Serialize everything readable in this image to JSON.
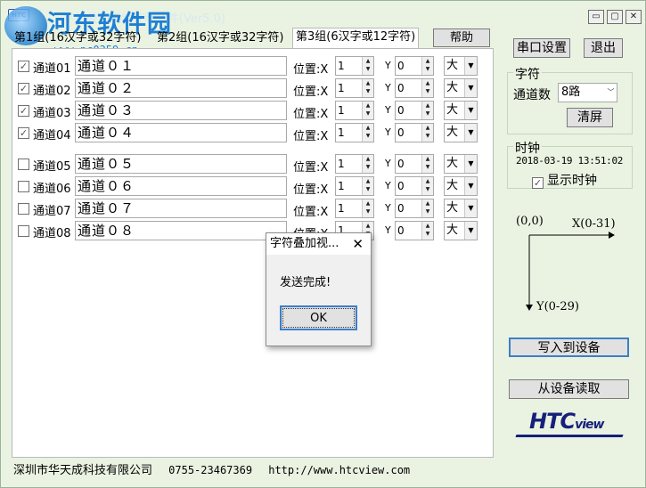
{
  "titlebar": {
    "app_icon": "HTC",
    "title": "字符叠加视频控制软件(Ver5.0)",
    "watermark_name": "河东软件园",
    "watermark_url": "www.pc0359.cn",
    "minimize": "▭",
    "maximize": "▢",
    "close": "✕"
  },
  "tabs": [
    {
      "label": "第1组(16汉字或32字符)"
    },
    {
      "label": "第2组(16汉字或32字符)"
    },
    {
      "label": "第3组(6汉字或12字符)"
    }
  ],
  "help_label": "帮助",
  "position_label": "位置:X",
  "y_label": "Y",
  "channels": [
    {
      "checked": true,
      "label": "通道01",
      "text": "通道０１",
      "x": "1",
      "y": "0",
      "size": "大"
    },
    {
      "checked": true,
      "label": "通道02",
      "text": "通道０２",
      "x": "1",
      "y": "0",
      "size": "大"
    },
    {
      "checked": true,
      "label": "通道03",
      "text": "通道０３",
      "x": "1",
      "y": "0",
      "size": "大"
    },
    {
      "checked": true,
      "label": "通道04",
      "text": "通道０４",
      "x": "1",
      "y": "0",
      "size": "大"
    },
    {
      "checked": false,
      "label": "通道05",
      "text": "通道０５",
      "x": "1",
      "y": "0",
      "size": "大"
    },
    {
      "checked": false,
      "label": "通道06",
      "text": "通道０６",
      "x": "1",
      "y": "0",
      "size": "大"
    },
    {
      "checked": false,
      "label": "通道07",
      "text": "通道０７",
      "x": "1",
      "y": "0",
      "size": "大"
    },
    {
      "checked": false,
      "label": "通道08",
      "text": "通道０８",
      "x": "1",
      "y": "0",
      "size": "大"
    }
  ],
  "right": {
    "serial_settings": "串口设置",
    "exit": "退出",
    "char_group": "字符",
    "channel_count_label": "通道数",
    "channel_count_value": "8路",
    "clear": "清屏",
    "clock_group": "时钟",
    "clock_time": "2018-03-19  13:51:02",
    "show_clock": "显示时钟",
    "show_clock_checked": true,
    "origin": "(0,0)",
    "x_axis": "X(0-31)",
    "y_axis": "Y(0-29)",
    "write_device": "写入到设备",
    "read_device": "从设备读取",
    "brand_main": "HTC",
    "brand_sub": "view"
  },
  "status": {
    "company": "深圳市华天成科技有限公司",
    "phone": "0755-23467369",
    "url": "http://www.htcview.com"
  },
  "dialog": {
    "title": "字符叠加视...",
    "close": "✕",
    "message": "发送完成!",
    "ok": "OK"
  }
}
